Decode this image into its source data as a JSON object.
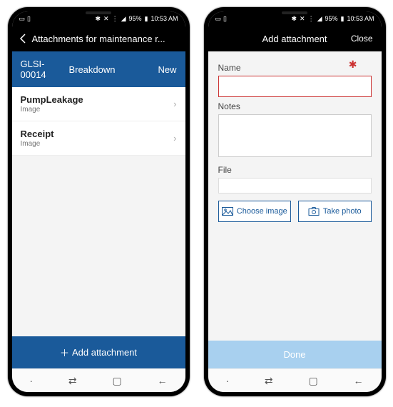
{
  "status": {
    "battery_pct": "95%",
    "time": "10:53 AM"
  },
  "left": {
    "header_title": "Attachments for maintenance r...",
    "info": {
      "id": "GLSI-00014",
      "type": "Breakdown",
      "state": "New"
    },
    "items": [
      {
        "title": "PumpLeakage",
        "sub": "Image"
      },
      {
        "title": "Receipt",
        "sub": "Image"
      }
    ],
    "add_label": "Add attachment"
  },
  "right": {
    "header_title": "Add attachment",
    "close_label": "Close",
    "name_label": "Name",
    "notes_label": "Notes",
    "file_label": "File",
    "choose_label": "Choose image",
    "photo_label": "Take photo",
    "done_label": "Done"
  }
}
